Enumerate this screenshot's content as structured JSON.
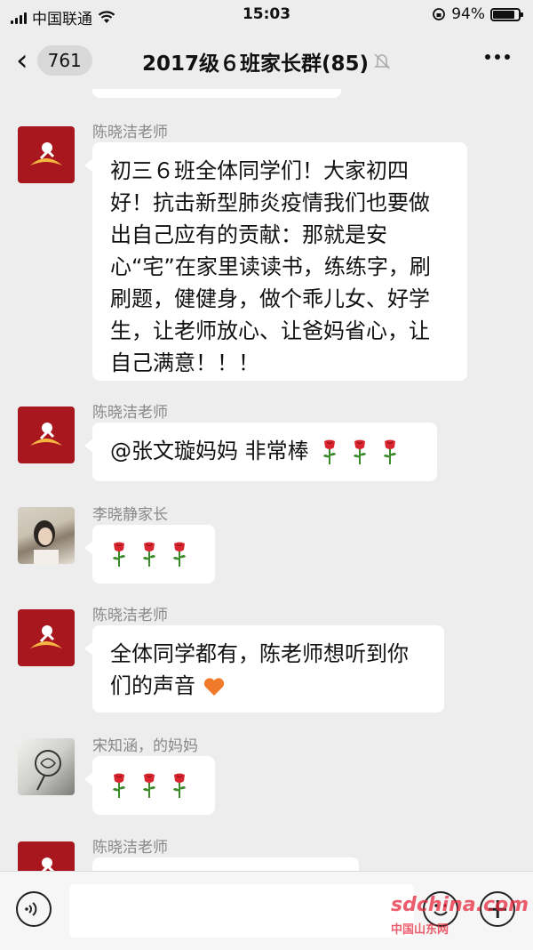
{
  "status_bar": {
    "carrier": "中国联通",
    "time": "15:03",
    "battery": "94%",
    "battery_level": 0.94
  },
  "nav": {
    "back_count": "761",
    "title": "2017级６班家长群(85)"
  },
  "messages": [
    {
      "sender": "陈晓洁老师",
      "text": "初三６班全体同学们！大家初四好！抗击新型肺炎疫情我们也要做出自己应有的贡献：那就是安心“宅”在家里读读书，练练字，刷刷题，健健身，做个乖儿女、好学生，让老师放心、让爸妈省心，让自己满意！！！"
    },
    {
      "sender": "陈晓洁老师",
      "text": "@张文璇妈妈 非常棒",
      "rose_count": 3
    },
    {
      "sender": "李晓静家长",
      "rose_count": 3
    },
    {
      "sender": "陈晓洁老师",
      "text": "全体同学都有，陈老师想听到你们的声音"
    },
    {
      "sender": "宋知涵，的妈妈",
      "rose_count": 3
    },
    {
      "sender": "陈晓洁老师"
    }
  ],
  "watermark": {
    "brand": "sdchina.com",
    "caption": "中国山东网"
  },
  "icons": {
    "back": "chevron-left-icon",
    "mute": "bell-off-icon",
    "more": "more-dots-icon",
    "voice": "voice-icon",
    "emoji": "emoji-icon",
    "plus": "plus-icon",
    "rose": "rose-emoji-icon",
    "heart": "orange-heart-emoji-icon"
  },
  "colors": {
    "teacher_avatar": "#a8161e",
    "background": "#ededed",
    "bubble": "#ffffff"
  }
}
